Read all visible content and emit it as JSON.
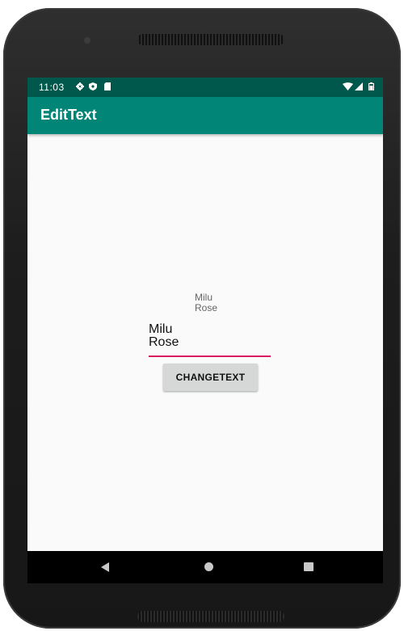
{
  "status_bar": {
    "time": "11:03",
    "left_icons": [
      "gear-icon",
      "shield-icon",
      "sd-card-icon"
    ],
    "right_icons": [
      "wifi-icon",
      "signal-icon",
      "battery-icon"
    ],
    "color": "#00574b"
  },
  "app_bar": {
    "title": "EditText",
    "color": "#008577"
  },
  "text_view": {
    "lines": [
      "Milu",
      "Rose"
    ]
  },
  "edit_text": {
    "lines": [
      "Milu",
      "Rose"
    ],
    "underline_color": "#d81b60"
  },
  "button": {
    "label": "CHANGETEXT"
  },
  "nav_bar": {
    "icons": [
      "back-icon",
      "home-icon",
      "recents-icon"
    ]
  }
}
